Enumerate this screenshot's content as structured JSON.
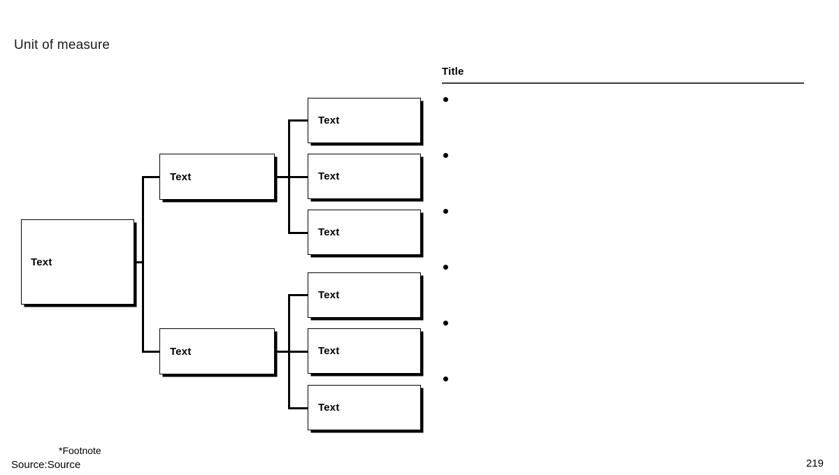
{
  "slide": {
    "unit_of_measure": "Unit of measure",
    "page_number": "219"
  },
  "tree": {
    "root": {
      "label": "Text"
    },
    "level2": [
      {
        "label": "Text"
      },
      {
        "label": "Text"
      }
    ],
    "leaves": [
      {
        "label": "Text"
      },
      {
        "label": "Text"
      },
      {
        "label": "Text"
      },
      {
        "label": "Text"
      },
      {
        "label": "Text"
      },
      {
        "label": "Text"
      }
    ]
  },
  "panel": {
    "title": "Title",
    "bullets": [
      "",
      "",
      "",
      "",
      "",
      ""
    ]
  },
  "footer": {
    "footnote": "*Footnote",
    "source": "Source:Source"
  },
  "colors": {
    "ink": "#000000",
    "background": "#ffffff",
    "rule": "#3a3a3a",
    "heading": "#1a1a1a"
  }
}
